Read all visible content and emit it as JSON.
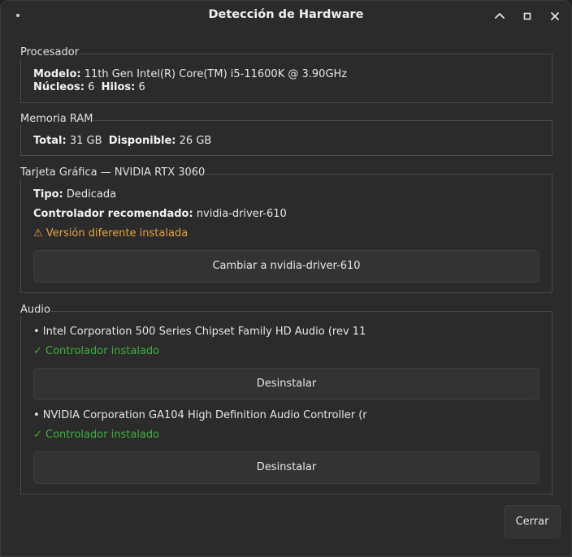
{
  "window": {
    "title": "Detección de Hardware",
    "minimize_icon": "chevron-up-icon",
    "maximize_icon": "square-icon",
    "close_icon": "close-icon"
  },
  "processor": {
    "section_label": "Procesador",
    "model_label": "Modelo:",
    "model_value": " 11th Gen Intel(R) Core(TM) i5-11600K @ 3.90GHz",
    "cores_label": "Núcleos:",
    "cores_value": " 6  ",
    "threads_label": "Hilos:",
    "threads_value": " 6"
  },
  "ram": {
    "section_label": "Memoria RAM",
    "total_label": "Total:",
    "total_value": " 31 GB  ",
    "available_label": "Disponible:",
    "available_value": " 26 GB"
  },
  "gpu": {
    "section_label": "Tarjeta Gráfica — NVIDIA RTX 3060",
    "type_label": "Tipo:",
    "type_value": " Dedicada",
    "driver_label": "Controlador recomendado:",
    "driver_value": " nvidia-driver-610",
    "warning": "⚠ Versión diferente instalada",
    "switch_button": "Cambiar a nvidia-driver-610"
  },
  "audio": {
    "section_label": "Audio",
    "devices": [
      {
        "name": "• Intel Corporation 500 Series Chipset Family HD Audio (rev 11",
        "status": "✓ Controlador instalado",
        "button": "Desinstalar"
      },
      {
        "name": "• NVIDIA Corporation GA104 High Definition Audio Controller (r",
        "status": "✓ Controlador instalado",
        "button": "Desinstalar"
      }
    ]
  },
  "footer": {
    "close_button": "Cerrar"
  },
  "colors": {
    "warning": "#e8a33d",
    "success": "#3fae3f",
    "background": "#2b2b2b"
  }
}
